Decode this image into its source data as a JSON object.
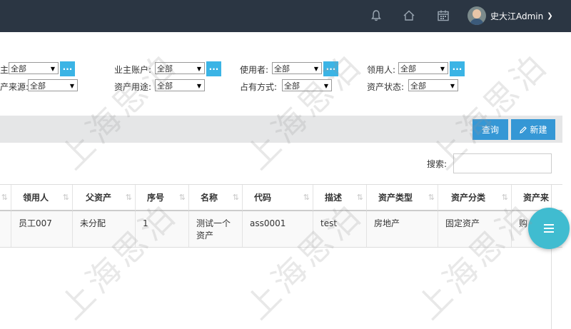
{
  "header": {
    "user_name": "史大江Admin",
    "icons": [
      "bell-icon",
      "home-icon",
      "calendar-icon",
      "chevron-down-icon"
    ]
  },
  "filters": {
    "row1": [
      {
        "label": "主:",
        "value": "全部"
      },
      {
        "label": "业主账户:",
        "value": "全部"
      },
      {
        "label": "使用者:",
        "value": "全部"
      },
      {
        "label": "领用人:",
        "value": "全部"
      }
    ],
    "row2": [
      {
        "label": "产来源:",
        "value": "全部"
      },
      {
        "label": "资产用途:",
        "value": "全部"
      },
      {
        "label": "占有方式:",
        "value": "全部"
      },
      {
        "label": "资产状态:",
        "value": "全部"
      }
    ],
    "lookup_label": "..."
  },
  "toolbar": {
    "query_label": "查询",
    "new_label": "新建"
  },
  "search": {
    "label": "搜索:",
    "value": ""
  },
  "table": {
    "columns": [
      "领用人",
      "父资产",
      "序号",
      "名称",
      "代码",
      "描述",
      "资产类型",
      "资产分类",
      "资产来"
    ],
    "rows": [
      [
        "员工007",
        "未分配",
        "1",
        "测试一个资产",
        "ass0001",
        "test",
        "房地产",
        "固定资产",
        "购"
      ]
    ]
  },
  "watermark": "上海思泊",
  "colors": {
    "topbar": "#2b3643",
    "accent": "#3597d5",
    "lookup": "#3bb4e5",
    "fab": "#40bcd0"
  }
}
